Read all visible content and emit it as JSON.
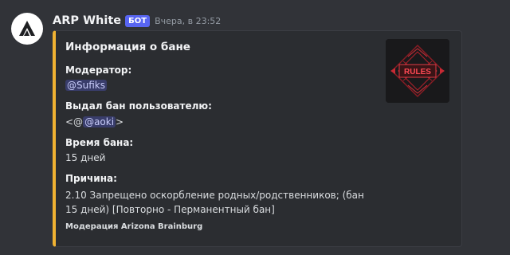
{
  "message": {
    "username": "ARP White",
    "bot_tag": "БОТ",
    "timestamp": "Вчера, в 23:52"
  },
  "embed": {
    "title": "Информация о бане",
    "fields": [
      {
        "name": "Модератор:",
        "mention": "@Sufiks"
      },
      {
        "name": "Выдал бан пользователю:",
        "prefix": "<@",
        "mention": "@aoki",
        "suffix": ">"
      },
      {
        "name": "Время бана:",
        "value": "15 дней"
      },
      {
        "name": "Причина:",
        "value": "2.10 Запрещено оскорбление родных/родственников; (бан 15 дней) [Повторно - Перманентный бан]"
      }
    ],
    "footer": "Модерация Arizona Brainburg",
    "accent_color": "#f0b232",
    "thumbnail_text": "RULES"
  },
  "colors": {
    "background": "#313338",
    "embed_bg": "#2b2d31",
    "mention_bg": "#3c4270",
    "bot_tag": "#5865f2"
  }
}
